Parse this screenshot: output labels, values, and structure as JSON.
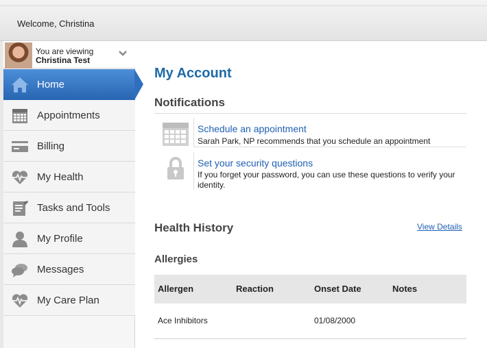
{
  "header": {
    "welcome": "Welcome, Christina"
  },
  "viewing": {
    "line1": "You are viewing",
    "name": "Christina Test"
  },
  "sidebar": {
    "items": [
      {
        "label": "Home",
        "icon": "home-icon",
        "active": true
      },
      {
        "label": "Appointments",
        "icon": "calendar-icon"
      },
      {
        "label": "Billing",
        "icon": "credit-card-icon"
      },
      {
        "label": "My Health",
        "icon": "heartbeat-icon"
      },
      {
        "label": "Tasks and Tools",
        "icon": "clipboard-icon"
      },
      {
        "label": "My Profile",
        "icon": "person-icon"
      },
      {
        "label": "Messages",
        "icon": "chat-bubbles-icon"
      },
      {
        "label": "My Care Plan",
        "icon": "heartbeat-icon"
      }
    ]
  },
  "main": {
    "title": "My Account",
    "notifications": {
      "heading": "Notifications",
      "items": [
        {
          "link": "Schedule an appointment",
          "description": "Sarah Park, NP recommends that you schedule an appointment",
          "icon": "calendar-icon"
        },
        {
          "link": "Set your security questions",
          "description": "If you forget your password, you can use these questions to verify your identity.",
          "icon": "lock-icon"
        }
      ]
    },
    "health_history": {
      "heading": "Health History",
      "view_details": "View Details"
    },
    "allergies": {
      "heading": "Allergies",
      "columns": [
        "Allergen",
        "Reaction",
        "Onset Date",
        "Notes"
      ],
      "rows": [
        [
          "Ace Inhibitors",
          "",
          "01/08/2000",
          ""
        ]
      ]
    }
  },
  "colors": {
    "accent": "#1d6aa8",
    "link": "#1f5fb3",
    "nav_active": "#2f6fbe",
    "icon_gray": "#8c8c8c"
  }
}
